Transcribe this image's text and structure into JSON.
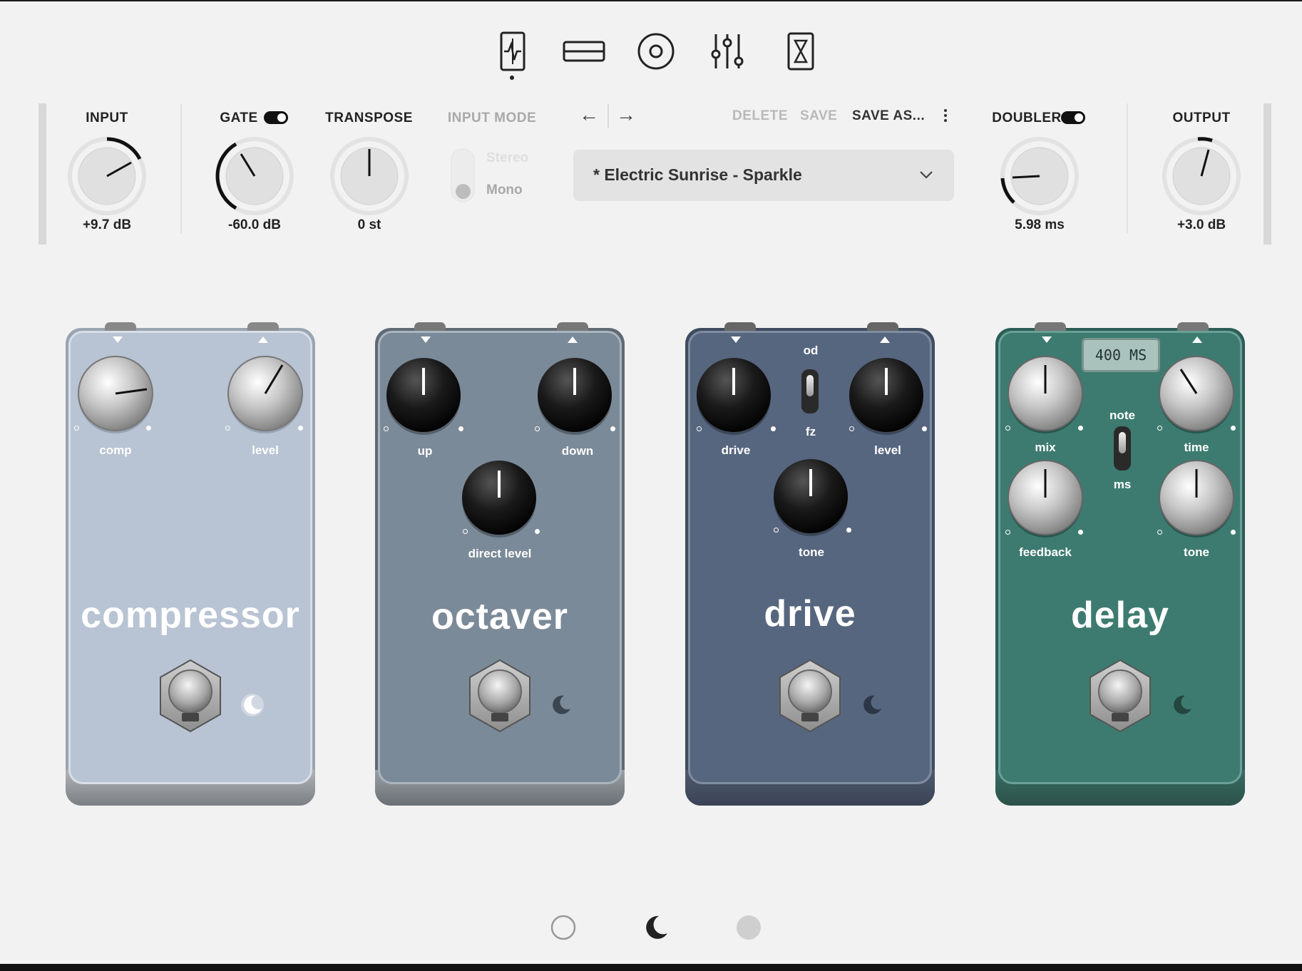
{
  "nav": {
    "icons": [
      "tuner-icon",
      "amp-icon",
      "speaker-icon",
      "mixer-icon",
      "timer-icon"
    ],
    "active_index": 0
  },
  "header": {
    "input": {
      "label": "INPUT",
      "value": "+9.7 dB"
    },
    "gate": {
      "label": "GATE",
      "value": "-60.0 dB",
      "enabled": true
    },
    "transpose": {
      "label": "TRANSPOSE",
      "value": "0 st"
    },
    "input_mode": {
      "label": "INPUT MODE",
      "options": [
        "Stereo",
        "Mono"
      ],
      "selected": "Mono"
    },
    "actions": {
      "delete": "DELETE",
      "save": "SAVE",
      "save_as": "SAVE AS..."
    },
    "preset": {
      "name": "* Electric Sunrise - Sparkle"
    },
    "doubler": {
      "label": "DOUBLER",
      "value": "5.98 ms",
      "enabled": true
    },
    "output": {
      "label": "OUTPUT",
      "value": "+3.0 dB"
    }
  },
  "pedals": {
    "compressor": {
      "name": "compressor",
      "knobs": [
        "comp",
        "level"
      ],
      "color": "#b7c2d3"
    },
    "octaver": {
      "name": "octaver",
      "knobs": [
        "up",
        "down",
        "direct level"
      ],
      "color": "#7a8a98"
    },
    "drive": {
      "name": "drive",
      "knobs": [
        "drive",
        "level",
        "tone"
      ],
      "switch_top": "od",
      "switch_bottom": "fz",
      "color": "#56657f"
    },
    "delay": {
      "name": "delay",
      "knobs": [
        "mix",
        "time",
        "feedback",
        "tone"
      ],
      "display": "400 MS",
      "switch_top": "note",
      "switch_bottom": "ms",
      "color": "#3d7b70"
    }
  },
  "pages": {
    "items": [
      "light-theme",
      "dark-theme",
      "dim-theme"
    ],
    "active_index": 1
  }
}
